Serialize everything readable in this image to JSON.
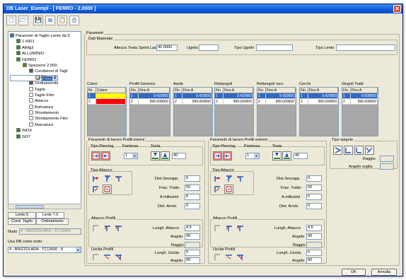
{
  "window": {
    "title": "DB Laser_Esempl - [ FERRO - 2.0000 ]",
    "close": "✕"
  },
  "toolbar": {
    "buttons": [
      {
        "name": "new-icon",
        "glyph": "🗋"
      },
      {
        "name": "open-icon",
        "glyph": "🗁"
      },
      {
        "name": "save-icon",
        "glyph": "💾"
      },
      {
        "name": "copy-icon",
        "glyph": "⧉"
      },
      {
        "name": "paste-icon",
        "glyph": "📋"
      },
      {
        "name": "print-icon",
        "glyph": "⎙"
      }
    ]
  },
  "tree": {
    "items": [
      {
        "label": "Parametri di Taglio Lente da 5",
        "indent": 0,
        "color": "#3a6ab8"
      },
      {
        "label": "1.4301",
        "indent": 1,
        "color": "#2e8b3a"
      },
      {
        "label": "AlMg3",
        "indent": 1,
        "color": "#2e8b3a"
      },
      {
        "label": "ALLUMINIO",
        "indent": 1,
        "color": "#2e8b3a"
      },
      {
        "label": "FERRO",
        "indent": 1,
        "color": "#2e8b3a"
      },
      {
        "label": "Spessore 2.000",
        "indent": 2,
        "color": "#8a6c2a"
      },
      {
        "label": "Condizioni di Tagli",
        "indent": 3,
        "color": "#5a5a5a"
      },
      {
        "label": "Pittura 1",
        "indent": 4,
        "color": "#c9c9c9",
        "selected": true
      },
      {
        "label": "Pittura 2",
        "indent": 4,
        "color": "#c9c9c9"
      },
      {
        "label": "Ordinamento",
        "indent": 3,
        "color": "#5a5a5a"
      },
      {
        "label": "Taglio",
        "indent": 3,
        "color": "#ffffff"
      },
      {
        "label": "Taglio Film",
        "indent": 3,
        "color": "#ffffff"
      },
      {
        "label": "Attacco",
        "indent": 3,
        "color": "#ffffff"
      },
      {
        "label": "Bulinatura",
        "indent": 3,
        "color": "#ffffff"
      },
      {
        "label": "Sfondamento",
        "indent": 3,
        "color": "#ffffff"
      },
      {
        "label": "Sfondamento Film",
        "indent": 3,
        "color": "#ffffff"
      },
      {
        "label": "Marcatura",
        "indent": 3,
        "color": "#ffffff"
      },
      {
        "label": "INOX",
        "indent": 1,
        "color": "#2e8b3a"
      },
      {
        "label": "St37",
        "indent": 1,
        "color": "#2e8b3a"
      }
    ]
  },
  "left_tabs": {
    "lente5": "Lente 5",
    "lente75": "Lente 7.5",
    "cond_taglio": "Cond. Taglio",
    "ordinamento": "Ordinamento"
  },
  "node": {
    "label": "Nodo",
    "value": "4 - BRIZZOLARA - TC13000"
  },
  "use_db": {
    "label": "Usa DB come nodo",
    "value": "4 - BRIZZOLARA - TC13000 - 8"
  },
  "params": {
    "title": "Parametri",
    "dati_materiale": "Dati Materiale",
    "altezza_label": "Altezza Testa Sprint Laser",
    "altezza_value": "40.0000",
    "ugello_label": "Ugello",
    "ugello_value": "",
    "tipo_ugello_label": "Tipo Ugello",
    "tipo_ugello_value": "",
    "tipo_lente_label": "Tipo Lente",
    "tipo_lente_value": ""
  },
  "grids": {
    "colori": {
      "title": "Colori",
      "headers": [
        "Nr.",
        "Colore"
      ],
      "rows": [
        [
          "1",
          ""
        ],
        [
          "2",
          ""
        ]
      ],
      "colors": [
        "#ffff00",
        "#ff0000"
      ]
    },
    "profili_generici": {
      "title": "Profili Generici",
      "headers": [
        "Fin.",
        "Fino A"
      ],
      "rows": [
        [
          "1",
          "9.420000"
        ],
        [
          "2",
          "999.000000"
        ]
      ]
    },
    "asole": {
      "title": "Asole",
      "headers": [
        "Fin.",
        "Fino A"
      ],
      "rows": [
        [
          "1",
          "9.420000"
        ],
        [
          "2",
          "999.000000"
        ]
      ]
    },
    "rettangoli": {
      "title": "Rettangoli",
      "headers": [
        "Fin.",
        "Fino A"
      ],
      "rows": [
        [
          "1",
          "9.420000"
        ],
        [
          "2",
          "999.000000"
        ]
      ]
    },
    "rettangoli_racc": {
      "title": "Rettangoli racc.",
      "headers": [
        "Fin.",
        "Fino A"
      ],
      "rows": [
        [
          "1",
          "9.420000"
        ],
        [
          "2",
          "999.000000"
        ]
      ]
    },
    "cerchi": {
      "title": "Cerchi",
      "headers": [
        "Fin.",
        "Fino A"
      ],
      "rows": [
        [
          "1",
          "9.420000"
        ],
        [
          "2",
          "999.000000"
        ]
      ]
    },
    "singoli_tratti": {
      "title": "Singoli Tratti",
      "headers": [
        "Fin.",
        "Fino A"
      ],
      "rows": [
        [
          "1",
          "0.000000"
        ],
        [
          "2",
          "999.000000"
        ]
      ]
    }
  },
  "interni": {
    "title": "Parametri di lavoro Profili interni",
    "tipo_piercing": "Tipo Piercing",
    "partenza": "Partenza",
    "partenza_value": "1",
    "testa": "Testa",
    "testa_value": "40",
    "tipo_attacco": "Tipo Attacco",
    "dist_sovrapp": "Dist.Sovrapp.",
    "dist_sovrapp_value": "0",
    "fraz_tratto": "Fraz. Tratto",
    "fraz_tratto_value": "50",
    "a_millesimi": "A millesimi",
    "a_millesimi_value": "0",
    "dist_arretr": "Dist. Arretr.",
    "dist_arretr_value": "0",
    "attacco_profili": "Attacco Profili",
    "lungh_attacco": "Lungh. Attacco",
    "lungh_attacco_value": "4.5",
    "angolo": "Angolo",
    "angolo_value": "90",
    "raggio": "Raggio",
    "raggio_value": "",
    "uscita_profili": "Uscita Profili",
    "lungh_uscita": "Lungh. Uscita",
    "lungh_uscita_value": "0",
    "angolo2": "Angolo",
    "angolo2_value": "90"
  },
  "esterni": {
    "title": "Parametri di lavoro Profili esterni",
    "tipo_piercing": "Tipo Piercing",
    "partenza": "Partenza",
    "partenza_value": "1",
    "testa": "Testa",
    "testa_value": "40",
    "tipo_attacco": "Tipo Attacco",
    "dist_sovrapp": "Dist.Sovrapp.",
    "dist_sovrapp_value": "0",
    "fraz_tratto": "Fraz. Tratto",
    "fraz_tratto_value": "50",
    "a_millesimi": "A millesimi",
    "a_millesimi_value": "0",
    "dist_arretr": "Dist. Arretr.",
    "dist_arretr_value": "0",
    "attacco_profili": "Attacco Profili",
    "lungh_attacco": "Lungh. Attacco",
    "lungh_attacco_value": "4.5",
    "angolo": "Angolo",
    "angolo_value": "90",
    "raggio": "Raggio",
    "raggio_value": "",
    "uscita_profili": "Uscita Profili",
    "lungh_uscita": "Lungh. Uscita",
    "lungh_uscita_value": "0",
    "angolo2": "Angolo",
    "angolo2_value": "90"
  },
  "spigolo": {
    "title": "Tipo spigolo",
    "raggio": "Raggio",
    "raggio_value": "",
    "angolo_soglia": "Angolo soglia",
    "angolo_soglia_value": ""
  },
  "footer": {
    "ok": "OK",
    "annulla": "Annulla"
  },
  "colors": {
    "accent": "#316ac5",
    "title_blue": "#0c58d8",
    "icon_blue": "#1f4fb8",
    "icon_red": "#d01818"
  }
}
